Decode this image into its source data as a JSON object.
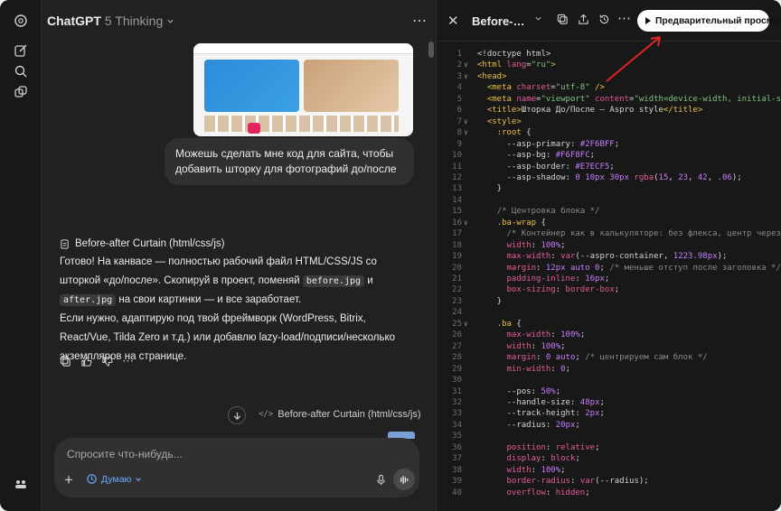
{
  "app": {
    "model_name": "ChatGPT",
    "model_version": "5 Thinking"
  },
  "chat": {
    "user_message": "Можешь сделать мне код для сайта, чтобы добавить шторку для фотографий до/после",
    "canvas_ref_title": "Before-after Curtain (html/css/js)",
    "answer_1_part1": "Готово! На канвасе — полностью рабочий файл HTML/CSS/JS со шторкой «до/после». Скопируй в проект, поменяй ",
    "code_before": "before.jpg",
    "answer_1_and": " и ",
    "code_after": "after.jpg",
    "answer_1_part2": " на свои картинки — и все заработает.",
    "answer_2": "Если нужно, адаптирую под твой фреймворк (WordPress, Bitrix, React/Vue, Tilda Zero и т.д.) или добавлю lazy-load/подписи/несколько экземпляров на странице.",
    "open_chip": "Before-after Curtain (html/css/js)"
  },
  "composer": {
    "placeholder": "Спросите что-нибудь...",
    "mode_label": "Думаю"
  },
  "panel": {
    "doc_title": "Before-after Curtain",
    "preview_button": "Предварительный просмотр"
  },
  "code_lines": [
    {
      "n": "1",
      "f": "",
      "h": "<span class='t-var'>&lt;!doctype html&gt;</span>"
    },
    {
      "n": "2",
      "f": "v",
      "h": "<span class='t-tag'>&lt;html</span> <span class='t-attr'>lang</span>=<span class='t-str'>\"ru\"</span><span class='t-tag'>&gt;</span>"
    },
    {
      "n": "3",
      "f": "v",
      "h": "<span class='t-tag'>&lt;head&gt;</span>"
    },
    {
      "n": "4",
      "f": "",
      "h": "  <span class='t-tag'>&lt;meta</span> <span class='t-attr'>charset</span>=<span class='t-str'>\"utf-8\"</span> <span class='t-tag'>/&gt;</span>"
    },
    {
      "n": "5",
      "f": "",
      "h": "  <span class='t-tag'>&lt;meta</span> <span class='t-attr'>name</span>=<span class='t-str'>\"viewport\"</span> <span class='t-attr'>content</span>=<span class='t-str'>\"width=device-width, initial-scale</span>"
    },
    {
      "n": "6",
      "f": "",
      "h": "  <span class='t-tag'>&lt;title&gt;</span>Шторка До/После — Aspro style<span class='t-tag'>&lt;/title&gt;</span>"
    },
    {
      "n": "7",
      "f": "v",
      "h": "  <span class='t-tag'>&lt;style&gt;</span>"
    },
    {
      "n": "8",
      "f": "v",
      "h": "    <span class='t-sel'>:root</span> {"
    },
    {
      "n": "9",
      "f": "",
      "h": "      --asp-primary: <span class='t-hex'>#2F6BFF</span>;"
    },
    {
      "n": "10",
      "f": "",
      "h": "      --asp-bg: <span class='t-hex'>#F6F8FC</span>;"
    },
    {
      "n": "11",
      "f": "",
      "h": "      --asp-border: <span class='t-hex'>#E7ECF5</span>;"
    },
    {
      "n": "12",
      "f": "",
      "h": "      --asp-shadow: <span class='t-num'>0 10px 30px</span> <span class='t-prop'>rgba</span>(<span class='t-num'>15</span>, <span class='t-num'>23</span>, <span class='t-num'>42</span>, <span class='t-num'>.06</span>);"
    },
    {
      "n": "13",
      "f": "",
      "h": "    }"
    },
    {
      "n": "14",
      "f": "",
      "h": ""
    },
    {
      "n": "15",
      "f": "",
      "h": "    <span class='t-cm'>/* Центровка блока */</span>"
    },
    {
      "n": "16",
      "f": "v",
      "h": "    <span class='t-sel'>.ba-wrap</span> {"
    },
    {
      "n": "17",
      "f": "",
      "h": "      <span class='t-cm'>/* Контейнер как в калькуляторе: без флекса, центр через ма</span>"
    },
    {
      "n": "18",
      "f": "",
      "h": "      <span class='t-prop'>width</span>: <span class='t-num'>100%</span>;"
    },
    {
      "n": "19",
      "f": "",
      "h": "      <span class='t-prop'>max-width</span>: <span class='t-prop'>var</span>(--aspro-container, <span class='t-num'>1223.98px</span>);"
    },
    {
      "n": "20",
      "f": "",
      "h": "      <span class='t-prop'>margin</span>: <span class='t-num'>12px auto 0</span>; <span class='t-cm'>/* меньше отступ после заголовка */</span>"
    },
    {
      "n": "21",
      "f": "",
      "h": "      <span class='t-prop'>padding-inline</span>: <span class='t-num'>16px</span>;"
    },
    {
      "n": "22",
      "f": "",
      "h": "      <span class='t-prop'>box-sizing</span>: <span class='t-prop'>border-box</span>;"
    },
    {
      "n": "23",
      "f": "",
      "h": "    }"
    },
    {
      "n": "24",
      "f": "",
      "h": ""
    },
    {
      "n": "25",
      "f": "v",
      "h": "    <span class='t-sel'>.ba</span> {"
    },
    {
      "n": "26",
      "f": "",
      "h": "      <span class='t-prop'>max-width</span>: <span class='t-num'>100%</span>;"
    },
    {
      "n": "27",
      "f": "",
      "h": "      <span class='t-prop'>width</span>: <span class='t-num'>100%</span>;"
    },
    {
      "n": "28",
      "f": "",
      "h": "      <span class='t-prop'>margin</span>: <span class='t-num'>0 auto</span>; <span class='t-cm'>/* центрируем сам блок */</span>"
    },
    {
      "n": "29",
      "f": "",
      "h": "      <span class='t-prop'>min-width</span>: <span class='t-num'>0</span>;"
    },
    {
      "n": "30",
      "f": "",
      "h": ""
    },
    {
      "n": "31",
      "f": "",
      "h": "      --pos: <span class='t-num'>50%</span>;"
    },
    {
      "n": "32",
      "f": "",
      "h": "      --handle-size: <span class='t-num'>48px</span>;"
    },
    {
      "n": "33",
      "f": "",
      "h": "      --track-height: <span class='t-num'>2px</span>;"
    },
    {
      "n": "34",
      "f": "",
      "h": "      --radius: <span class='t-num'>20px</span>;"
    },
    {
      "n": "35",
      "f": "",
      "h": ""
    },
    {
      "n": "36",
      "f": "",
      "h": "      <span class='t-prop'>position</span>: <span class='t-prop'>relative</span>;"
    },
    {
      "n": "37",
      "f": "",
      "h": "      <span class='t-prop'>display</span>: <span class='t-prop'>block</span>;"
    },
    {
      "n": "38",
      "f": "",
      "h": "      <span class='t-prop'>width</span>: <span class='t-num'>100%</span>;"
    },
    {
      "n": "39",
      "f": "",
      "h": "      <span class='t-prop'>border-radius</span>: <span class='t-prop'>var</span>(--radius);"
    },
    {
      "n": "40",
      "f": "",
      "h": "      <span class='t-prop'>overflow</span>: <span class='t-prop'>hidden</span>;"
    }
  ]
}
